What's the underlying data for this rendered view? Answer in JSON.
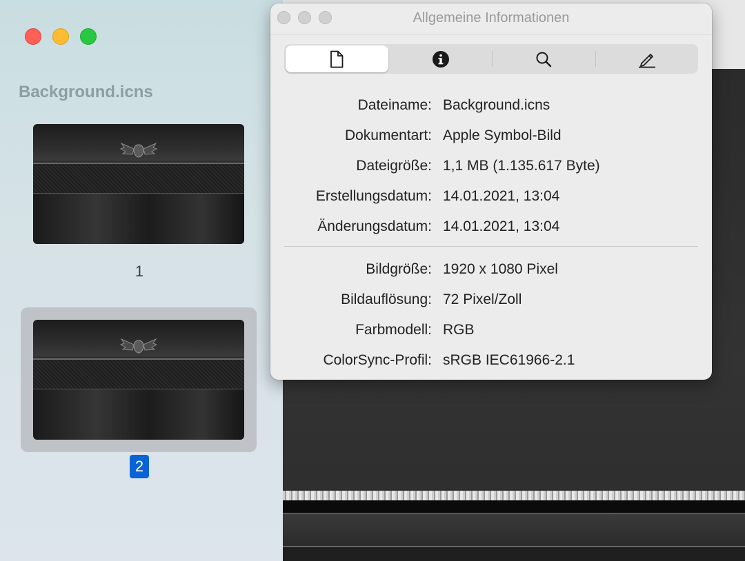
{
  "sidebar": {
    "title": "Background.icns",
    "pages": [
      {
        "label": "1",
        "selected": false
      },
      {
        "label": "2",
        "selected": true
      }
    ]
  },
  "panel": {
    "title": "Allgemeine Informationen",
    "tabs": [
      {
        "icon": "document-icon",
        "active": true
      },
      {
        "icon": "info-icon",
        "active": false
      },
      {
        "icon": "search-icon",
        "active": false
      },
      {
        "icon": "pencil-icon",
        "active": false
      }
    ],
    "general": [
      {
        "label": "Dateiname:",
        "value": "Background.icns"
      },
      {
        "label": "Dokumentart:",
        "value": "Apple Symbol-Bild"
      },
      {
        "label": "Dateigröße:",
        "value": "1,1 MB (1.135.617 Byte)"
      },
      {
        "label": "Erstellungsdatum:",
        "value": "14.01.2021, 13:04"
      },
      {
        "label": "Änderungsdatum:",
        "value": "14.01.2021, 13:04"
      }
    ],
    "image": [
      {
        "label": "Bildgröße:",
        "value": "1920 x 1080 Pixel"
      },
      {
        "label": "Bildauflösung:",
        "value": "72 Pixel/Zoll"
      },
      {
        "label": "Farbmodell:",
        "value": "RGB"
      },
      {
        "label": "ColorSync-Profil:",
        "value": "sRGB IEC61966-2.1"
      }
    ]
  },
  "colors": {
    "selection_blue": "#0a63d6",
    "close": "#fe5f57",
    "minimize": "#febc2e",
    "zoom": "#28c840"
  }
}
